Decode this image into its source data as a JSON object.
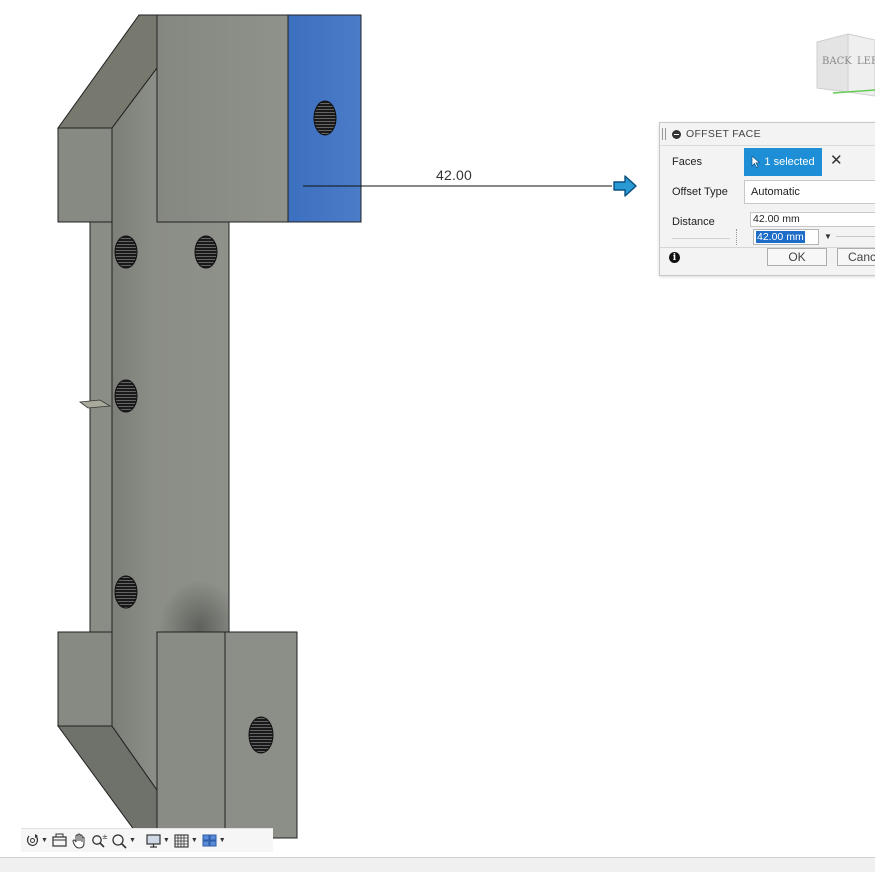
{
  "dimension": {
    "value": "42.00"
  },
  "viewcube": {
    "back_label": "BACK",
    "left_label": "LEFT"
  },
  "dialog": {
    "title": "OFFSET FACE",
    "faces_label": "Faces",
    "faces_selection": "1 selected",
    "offset_type_label": "Offset Type",
    "offset_type_value": "Automatic",
    "distance_label": "Distance",
    "distance_value": "42.00 mm",
    "distance_spin_value": "42.00 mm",
    "ok_label": "OK",
    "cancel_label": "Cancel"
  },
  "colors": {
    "selected_face": "#4a7cc8",
    "model_gray": "#8a8d85",
    "accent_blue": "#1e8fd6"
  },
  "navbar": {
    "items": [
      "orbit-icon",
      "look-at-icon",
      "pan-icon",
      "zoom-icon",
      "fit-icon",
      "display-settings-icon",
      "grid-settings-icon",
      "viewports-icon"
    ]
  }
}
